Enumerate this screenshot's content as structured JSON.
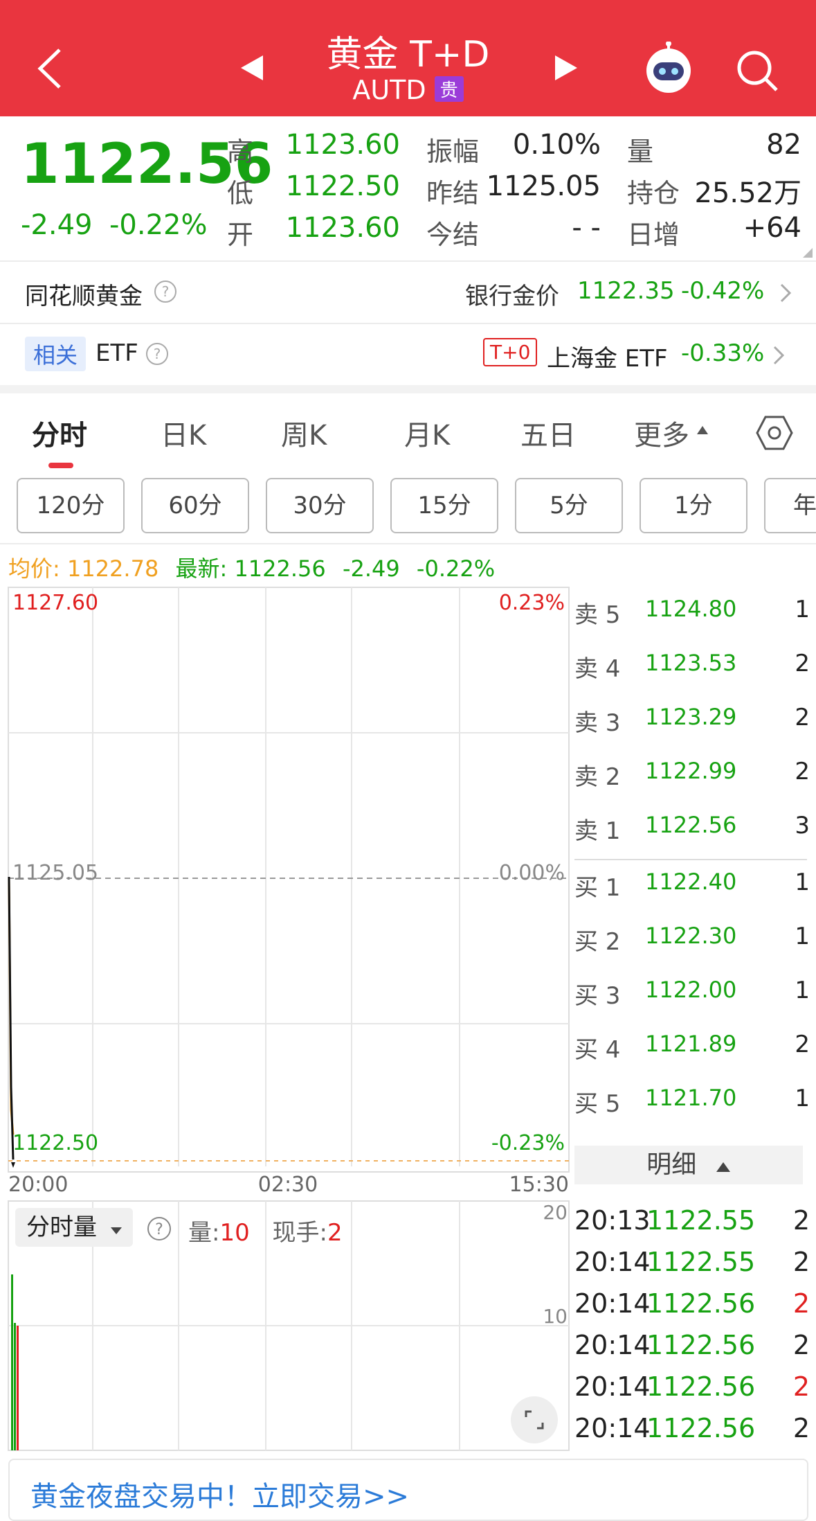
{
  "header": {
    "title": "黄金 T+D",
    "code": "AUTD",
    "badge": "贵",
    "bg_color": "#e9353f"
  },
  "icons": [
    "back-arrow-icon",
    "prev-triangle-icon",
    "next-triangle-icon",
    "robot-avatar-icon",
    "search-icon",
    "help-icon",
    "chevron-right-icon",
    "settings-hexagon-icon",
    "triangle-up-icon",
    "dropdown-triangle-icon",
    "expand-icon"
  ],
  "quote": {
    "price": "1122.56",
    "change": "-2.49",
    "change_pct": "-0.22%",
    "high_label": "高",
    "high": "1123.60",
    "low_label": "低",
    "low": "1122.50",
    "open_label": "开",
    "open": "1123.60",
    "amp_label": "振幅",
    "amp": "0.10%",
    "prev_label": "昨结",
    "prev": "1125.05",
    "today_label": "今结",
    "today": "- -",
    "vol_label": "量",
    "vol": "82",
    "pos_label": "持仓",
    "pos": "25.52万",
    "inc_label": "日增",
    "inc": "+64"
  },
  "bank": {
    "label": "同花顺黄金",
    "bank_label": "银行金价",
    "bank_price": "1122.35",
    "bank_pct": "-0.42%"
  },
  "etf": {
    "tag": "相关",
    "label": "ETF",
    "t0": "T+0",
    "name": "上海金 ETF",
    "pct": "-0.33%"
  },
  "tabs": [
    "分时",
    "日K",
    "周K",
    "月K",
    "五日",
    "更多"
  ],
  "chips": [
    "120分",
    "60分",
    "30分",
    "15分",
    "5分",
    "1分",
    "年"
  ],
  "info_line": {
    "avg_label": "均价:",
    "avg": "1122.78",
    "last_label": "最新:",
    "last": "1122.56",
    "chg": "-2.49",
    "pct": "-0.22%"
  },
  "chart_data": {
    "type": "line",
    "y_top_label": "1127.60",
    "y_mid_label": "1125.05",
    "y_bottom_label": "1122.50",
    "pct_top": "0.23%",
    "pct_mid": "0.00%",
    "pct_bottom": "-0.23%",
    "x_labels": [
      "20:00",
      "02:30",
      "15:30"
    ],
    "ylim": [
      1122.5,
      1127.6
    ],
    "series": [
      {
        "name": "最新",
        "values": [
          1125.05,
          1123.2,
          1122.56
        ]
      },
      {
        "name": "均价",
        "values": [
          1125.05,
          1123.0,
          1122.78
        ]
      }
    ]
  },
  "order_book": {
    "sell": [
      {
        "label": "卖 5",
        "price": "1124.80",
        "qty": "1"
      },
      {
        "label": "卖 4",
        "price": "1123.53",
        "qty": "2"
      },
      {
        "label": "卖 3",
        "price": "1123.29",
        "qty": "2"
      },
      {
        "label": "卖 2",
        "price": "1122.99",
        "qty": "2"
      },
      {
        "label": "卖 1",
        "price": "1122.56",
        "qty": "3"
      }
    ],
    "buy": [
      {
        "label": "买 1",
        "price": "1122.40",
        "qty": "1"
      },
      {
        "label": "买 2",
        "price": "1122.30",
        "qty": "1"
      },
      {
        "label": "买 3",
        "price": "1122.00",
        "qty": "1"
      },
      {
        "label": "买 4",
        "price": "1121.89",
        "qty": "2"
      },
      {
        "label": "买 5",
        "price": "1121.70",
        "qty": "1"
      }
    ],
    "detail_label": "明细"
  },
  "volume": {
    "selector": "分时量",
    "vol_label": "量:",
    "vol": "10",
    "hand_label": "现手:",
    "hand": "2",
    "y_top": "20",
    "y_mid": "10"
  },
  "ticks": [
    {
      "time": "20:13",
      "price": "1122.55",
      "qty": "2",
      "up": false
    },
    {
      "time": "20:14",
      "price": "1122.55",
      "qty": "2",
      "up": false
    },
    {
      "time": "20:14",
      "price": "1122.56",
      "qty": "2",
      "up": true
    },
    {
      "time": "20:14",
      "price": "1122.56",
      "qty": "2",
      "up": false
    },
    {
      "time": "20:14",
      "price": "1122.56",
      "qty": "2",
      "up": true
    },
    {
      "time": "20:14",
      "price": "1122.56",
      "qty": "2",
      "up": false
    }
  ],
  "footer": {
    "banner": "黄金夜盘交易中！立即交易>>"
  }
}
